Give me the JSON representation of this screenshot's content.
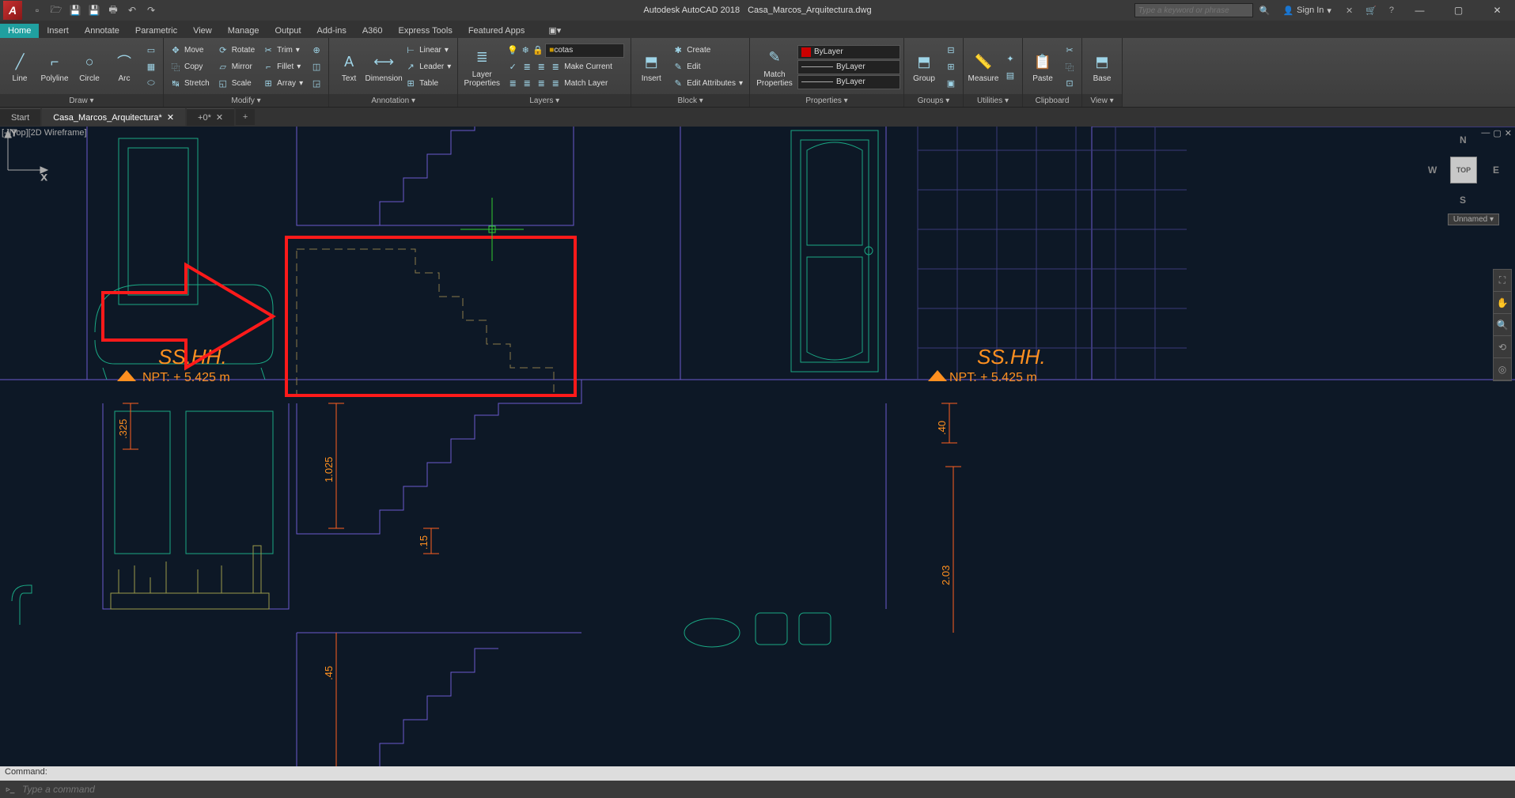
{
  "title": {
    "app": "Autodesk AutoCAD 2018",
    "doc": "Casa_Marcos_Arquitectura.dwg"
  },
  "search_placeholder": "Type a keyword or phrase",
  "signin": "Sign In",
  "ribbon_tabs": [
    "Home",
    "Insert",
    "Annotate",
    "Parametric",
    "View",
    "Manage",
    "Output",
    "Add-ins",
    "A360",
    "Express Tools",
    "Featured Apps"
  ],
  "panels": {
    "draw": {
      "title": "Draw ▾",
      "line": "Line",
      "polyline": "Polyline",
      "circle": "Circle",
      "arc": "Arc"
    },
    "modify": {
      "title": "Modify ▾",
      "move": "Move",
      "rotate": "Rotate",
      "trim": "Trim",
      "copy": "Copy",
      "mirror": "Mirror",
      "fillet": "Fillet",
      "stretch": "Stretch",
      "scale": "Scale",
      "array": "Array"
    },
    "annotation": {
      "title": "Annotation ▾",
      "text": "Text",
      "dimension": "Dimension",
      "linear": "Linear",
      "leader": "Leader",
      "table": "Table"
    },
    "layers": {
      "title": "Layers ▾",
      "props": "Layer Properties",
      "current": "cotas",
      "make": "Make Current",
      "match": "Match Layer"
    },
    "block": {
      "title": "Block ▾",
      "insert": "Insert",
      "create": "Create",
      "edit": "Edit",
      "editattr": "Edit Attributes"
    },
    "properties": {
      "title": "Properties ▾",
      "match": "Match Properties",
      "bylayer": "ByLayer",
      "byl2": "ByLayer",
      "byl3": "ByLayer"
    },
    "groups": {
      "title": "Groups ▾",
      "group": "Group"
    },
    "utilities": {
      "title": "Utilities ▾",
      "measure": "Measure"
    },
    "clipboard": {
      "title": "Clipboard",
      "paste": "Paste"
    },
    "view": {
      "title": "View ▾",
      "base": "Base"
    }
  },
  "file_tabs": {
    "start": "Start",
    "file1": "Casa_Marcos_Arquitectura*",
    "file2": "+0*"
  },
  "view_label": "[-][Top][2D Wireframe]",
  "viewcube": {
    "top": "TOP",
    "n": "N",
    "s": "S",
    "e": "E",
    "w": "W",
    "unnamed": "Unnamed ▾"
  },
  "drawing": {
    "room1_label": "SS.HH.",
    "room1_npt": "NPT: + 5.425 m",
    "room2_label": "SS.HH.",
    "room2_npt": "NPT: + 5.425 m",
    "dim1": ".325",
    "dim2": "1.025",
    "dim3": ".15",
    "dim4": ".40",
    "dim5": "2.03",
    "dim6": ".45"
  },
  "cmd": {
    "history": "Command:",
    "placeholder": "Type a command"
  },
  "ucs": {
    "y": "Y",
    "x": "X"
  }
}
